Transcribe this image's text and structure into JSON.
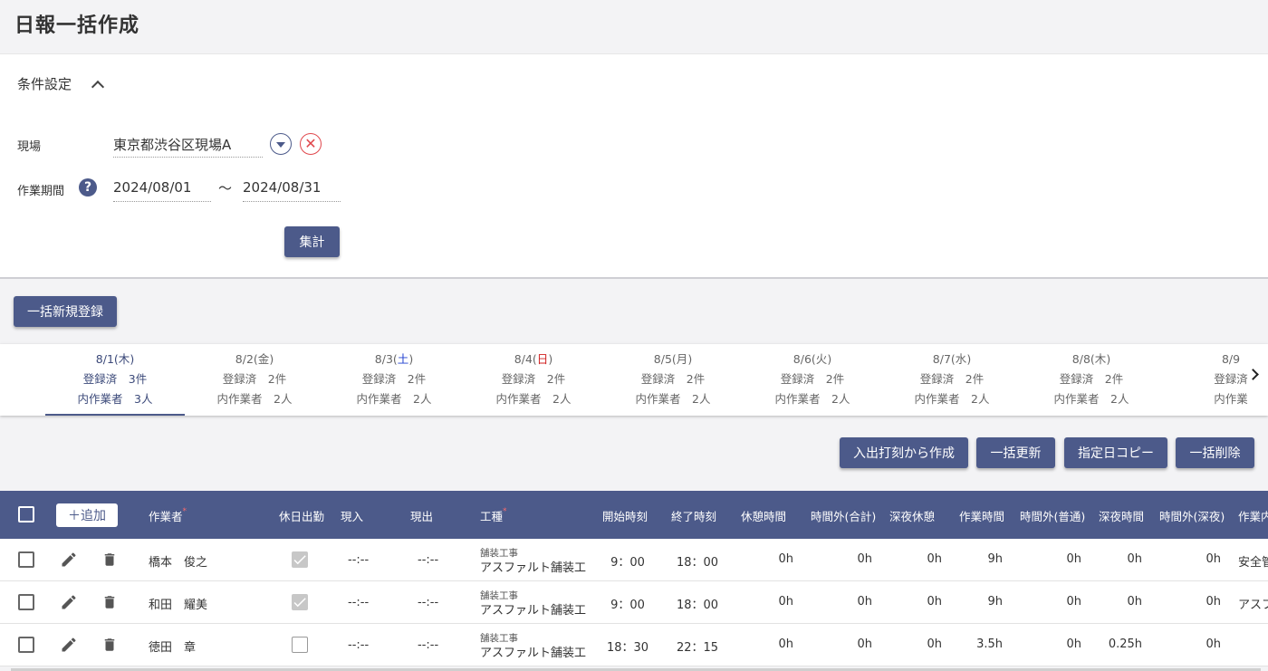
{
  "page": {
    "title": "日報一括作成"
  },
  "conditions": {
    "header": "条件設定",
    "site_label": "現場",
    "site_value": "東京都渋谷区現場A",
    "period_label": "作業期間",
    "period_from": "2024/08/01",
    "period_separator": "〜",
    "period_to": "2024/08/31",
    "aggregate_button": "集計"
  },
  "bulk_new_button": "一括新規登録",
  "days": [
    {
      "date": "8/1(",
      "dow": "木",
      "close": ")",
      "dow_class": "",
      "registered": "登録済　3件",
      "workers": "内作業者　3人",
      "active": true
    },
    {
      "date": "8/2(",
      "dow": "金",
      "close": ")",
      "dow_class": "",
      "registered": "登録済　2件",
      "workers": "内作業者　2人",
      "active": false
    },
    {
      "date": "8/3(",
      "dow": "土",
      "close": ")",
      "dow_class": "sat",
      "registered": "登録済　2件",
      "workers": "内作業者　2人",
      "active": false
    },
    {
      "date": "8/4(",
      "dow": "日",
      "close": ")",
      "dow_class": "sun",
      "registered": "登録済　2件",
      "workers": "内作業者　2人",
      "active": false
    },
    {
      "date": "8/5(",
      "dow": "月",
      "close": ")",
      "dow_class": "",
      "registered": "登録済　2件",
      "workers": "内作業者　2人",
      "active": false
    },
    {
      "date": "8/6(",
      "dow": "火",
      "close": ")",
      "dow_class": "",
      "registered": "登録済　2件",
      "workers": "内作業者　2人",
      "active": false
    },
    {
      "date": "8/7(",
      "dow": "水",
      "close": ")",
      "dow_class": "",
      "registered": "登録済　2件",
      "workers": "内作業者　2人",
      "active": false
    },
    {
      "date": "8/8(",
      "dow": "木",
      "close": ")",
      "dow_class": "",
      "registered": "登録済　2件",
      "workers": "内作業者　2人",
      "active": false
    },
    {
      "date": "8/9",
      "dow": "",
      "close": "",
      "dow_class": "",
      "registered": "登録済",
      "workers": "内作業",
      "active": false
    }
  ],
  "actions": {
    "create_from_clock": "入出打刻から作成",
    "bulk_update": "一括更新",
    "copy_date": "指定日コピー",
    "bulk_delete": "一括削除"
  },
  "table": {
    "add_label": "＋追加",
    "columns": {
      "worker": "作業者",
      "holiday": "休日出勤",
      "arrive": "現入",
      "leave": "現出",
      "process": "工種",
      "start": "開始時刻",
      "end": "終了時刻",
      "rest": "休憩時間",
      "overtime_total": "時間外(合計)",
      "night_rest": "深夜休憩",
      "work_time": "作業時間",
      "overtime_normal": "時間外(普通)",
      "night_time": "深夜時間",
      "overtime_night": "時間外(深夜)",
      "work_content": "作業内"
    },
    "rows": [
      {
        "worker": "橋本　俊之",
        "holiday": true,
        "arrive": "--:--",
        "leave": "--:--",
        "process_cat": "舗装工事",
        "process": "アスファルト舗装工",
        "start": "9：00",
        "end": "18：00",
        "rest": "0h",
        "overtime_total": "0h",
        "night_rest": "0h",
        "work_time": "9h",
        "overtime_normal": "0h",
        "night_time": "0h",
        "overtime_night": "0h",
        "content": "安全管"
      },
      {
        "worker": "和田　耀美",
        "holiday": true,
        "arrive": "--:--",
        "leave": "--:--",
        "process_cat": "舗装工事",
        "process": "アスファルト舗装工",
        "start": "9：00",
        "end": "18：00",
        "rest": "0h",
        "overtime_total": "0h",
        "night_rest": "0h",
        "work_time": "9h",
        "overtime_normal": "0h",
        "night_time": "0h",
        "overtime_night": "0h",
        "content": "アスフ"
      },
      {
        "worker": "徳田　章",
        "holiday": false,
        "arrive": "--:--",
        "leave": "--:--",
        "process_cat": "舗装工事",
        "process": "アスファルト舗装工",
        "start": "18：30",
        "end": "22：15",
        "rest": "0h",
        "overtime_total": "0h",
        "night_rest": "0h",
        "work_time": "3.5h",
        "overtime_normal": "0h",
        "night_time": "0.25h",
        "overtime_night": "0h",
        "content": ""
      }
    ]
  },
  "colors": {
    "primary": "#4c5a8a",
    "danger": "#e0474c",
    "saturday": "#2040d0",
    "sunday": "#d02020"
  }
}
